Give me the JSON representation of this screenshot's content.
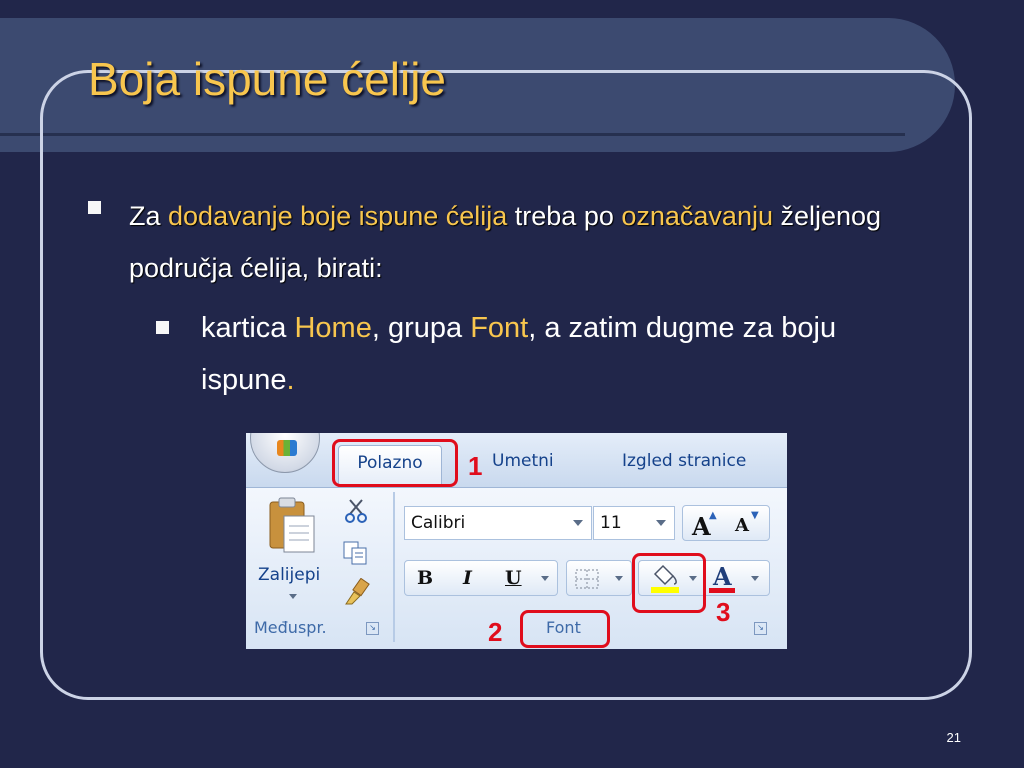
{
  "slide": {
    "title": "Boja ispune ćelije",
    "page_number": "21"
  },
  "bullet1": {
    "t1": "Za ",
    "t2": "dodavanje boje ispune ćelija",
    "t3": " treba po ",
    "t4": "označavanju",
    "t5": " željenog područja ćelija, birati:"
  },
  "bullet2": {
    "t1": "kartica ",
    "t2": "Home",
    "t3": ", grupa ",
    "t4": "Font",
    "t5": ", a zatim dugme za boju ispune",
    "t6": "."
  },
  "ribbon": {
    "tabs": [
      "Polazno",
      "Umetni",
      "Izgled stranice"
    ],
    "paste_label": "Zalijepi",
    "clipboard_group": "Međuspr.",
    "font_group": "Font",
    "font_name": "Calibri",
    "font_size": "11",
    "bold": "B",
    "italic": "I",
    "underline": "U",
    "font_color_letter": "A",
    "grow_font": "A",
    "shrink_font": "A"
  },
  "callouts": [
    "1",
    "2",
    "3"
  ],
  "colors": {
    "background": "#21264a",
    "title": "#f8c64e",
    "highlight": "#f8c64e",
    "callout_red": "#e00d1c",
    "fill_yellow": "#ffff00"
  }
}
